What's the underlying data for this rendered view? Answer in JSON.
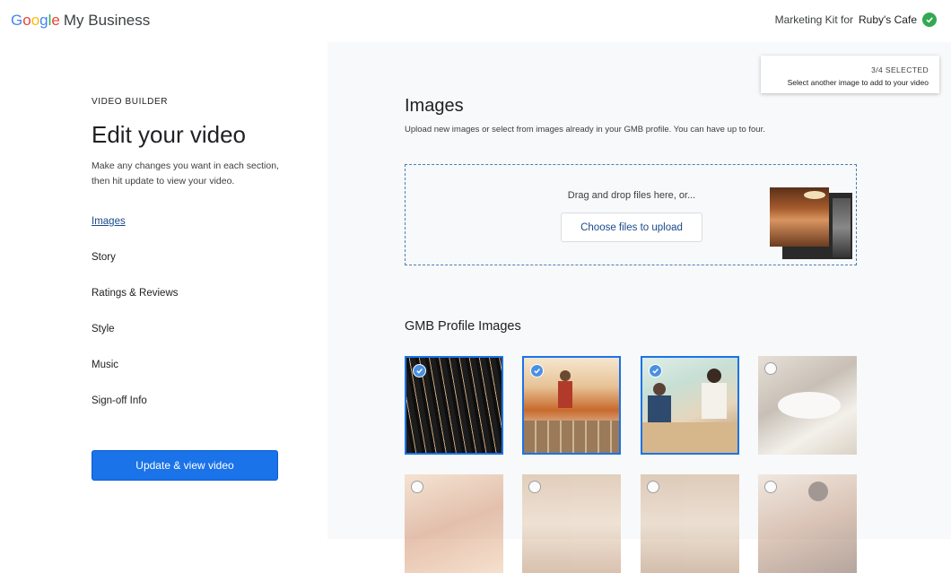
{
  "header": {
    "logo_google": "Google",
    "logo_product": "My Business",
    "kit_prefix": "Marketing Kit for",
    "business_name": "Ruby's Cafe"
  },
  "sidebar": {
    "eyebrow": "VIDEO BUILDER",
    "title": "Edit your video",
    "description": "Make any changes you want in each section, then hit update to view your video.",
    "nav": [
      "Images",
      "Story",
      "Ratings & Reviews",
      "Style",
      "Music",
      "Sign-off Info"
    ],
    "active_nav": "Images",
    "update_button": "Update & view video"
  },
  "toast": {
    "count": "3/4 SELECTED",
    "message": "Select another image to add to your video"
  },
  "images_section": {
    "title": "Images",
    "subtitle": "Upload new images or select from images already in your GMB profile. You can have up to four.",
    "drop_text": "Drag and drop files here, or...",
    "upload_button": "Choose files to upload"
  },
  "gallery": {
    "title": "GMB Profile Images",
    "images": [
      {
        "selected": true
      },
      {
        "selected": true
      },
      {
        "selected": true
      },
      {
        "selected": false
      },
      {
        "selected": false
      },
      {
        "selected": false
      },
      {
        "selected": false
      },
      {
        "selected": false
      }
    ]
  },
  "colors": {
    "accent": "#1a73e8",
    "link": "#1a4a8a",
    "success": "#34a853",
    "panel_bg": "#f8f9fa"
  }
}
